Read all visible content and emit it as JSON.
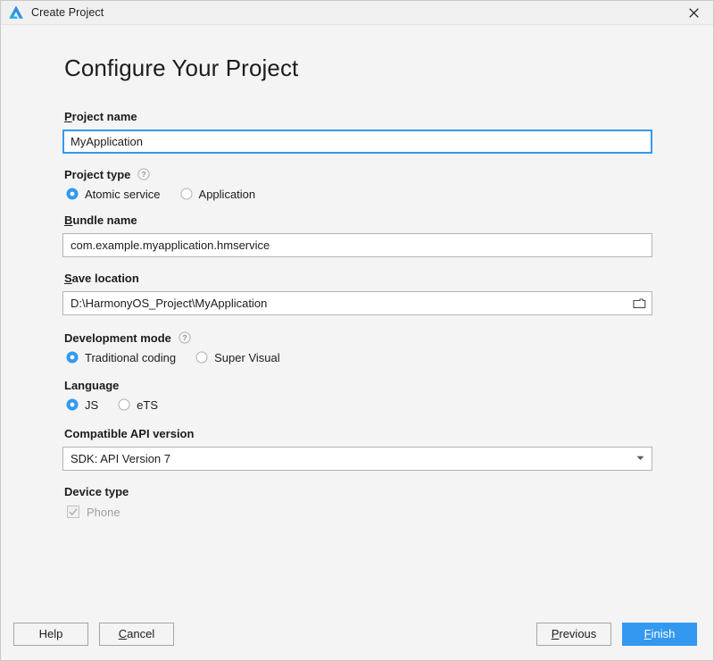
{
  "window": {
    "title": "Create Project",
    "logo_icon": "deveco-triangle-logo",
    "close_icon": "close-icon"
  },
  "colors": {
    "accent": "#3399f0",
    "background": "#f4f4f4",
    "input_background": "#ffffff",
    "input_border": "#b4b4b4",
    "text": "#1c1c1c",
    "disabled_text": "#a0a0a0"
  },
  "main": {
    "heading": "Configure Your Project",
    "project_name": {
      "label": "Project name",
      "mnemonic": "P",
      "label_rest": "roject name",
      "value": "MyApplication",
      "focused": true
    },
    "project_type": {
      "label": "Project type",
      "help_icon": "help-question-icon",
      "options": [
        {
          "label": "Atomic service",
          "selected": true
        },
        {
          "label": "Application",
          "selected": false
        }
      ]
    },
    "bundle_name": {
      "label": "Bundle name",
      "mnemonic": "B",
      "label_rest": "undle name",
      "value": "com.example.myapplication.hmservice"
    },
    "save_location": {
      "label": "Save location",
      "mnemonic": "S",
      "label_rest": "ave location",
      "value": "D:\\HarmonyOS_Project\\MyApplication",
      "browse_icon": "folder-icon"
    },
    "development_mode": {
      "label": "Development mode",
      "help_icon": "help-question-icon",
      "options": [
        {
          "label": "Traditional coding",
          "selected": true
        },
        {
          "label": "Super Visual",
          "selected": false
        }
      ]
    },
    "language": {
      "label": "Language",
      "options": [
        {
          "label": "JS",
          "selected": true
        },
        {
          "label": "eTS",
          "selected": false
        }
      ]
    },
    "api_version": {
      "label": "Compatible API version",
      "value": "SDK: API Version 7",
      "arrow_icon": "chevron-down-icon"
    },
    "device_type": {
      "label": "Device type",
      "options": [
        {
          "label": "Phone",
          "checked": true,
          "disabled": true
        }
      ]
    }
  },
  "footer": {
    "help": {
      "label": "Help"
    },
    "cancel": {
      "mnemonic": "C",
      "label_rest": "ancel"
    },
    "previous": {
      "mnemonic": "P",
      "label_rest": "revious"
    },
    "finish": {
      "mnemonic": "F",
      "label_rest": "inish"
    }
  }
}
